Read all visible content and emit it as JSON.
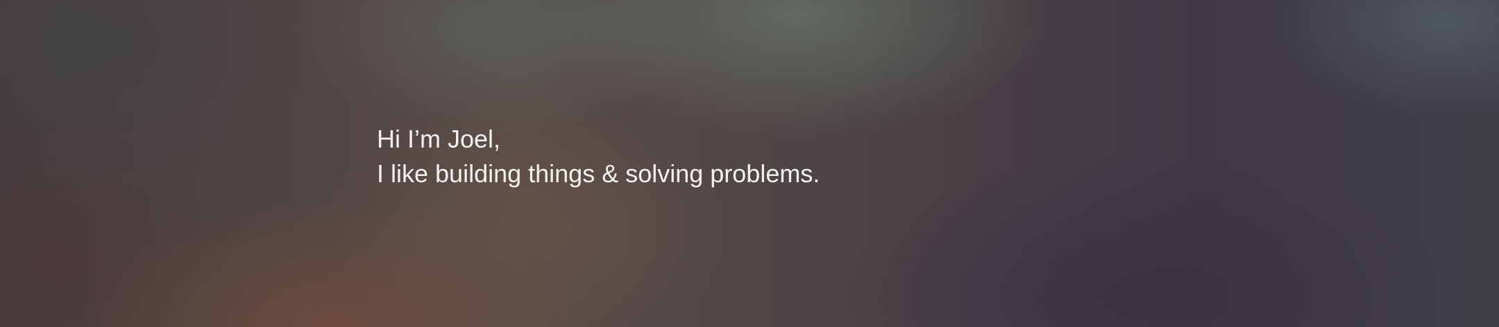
{
  "hero": {
    "greeting": "Hi I’m Joel,",
    "tagline": "I like building things & solving problems."
  },
  "colors": {
    "text": "#f4f2f0",
    "background_base": "#433c40",
    "glow_green": "#687668",
    "glow_rust": "#704c3c",
    "glow_violet": "#383242"
  }
}
